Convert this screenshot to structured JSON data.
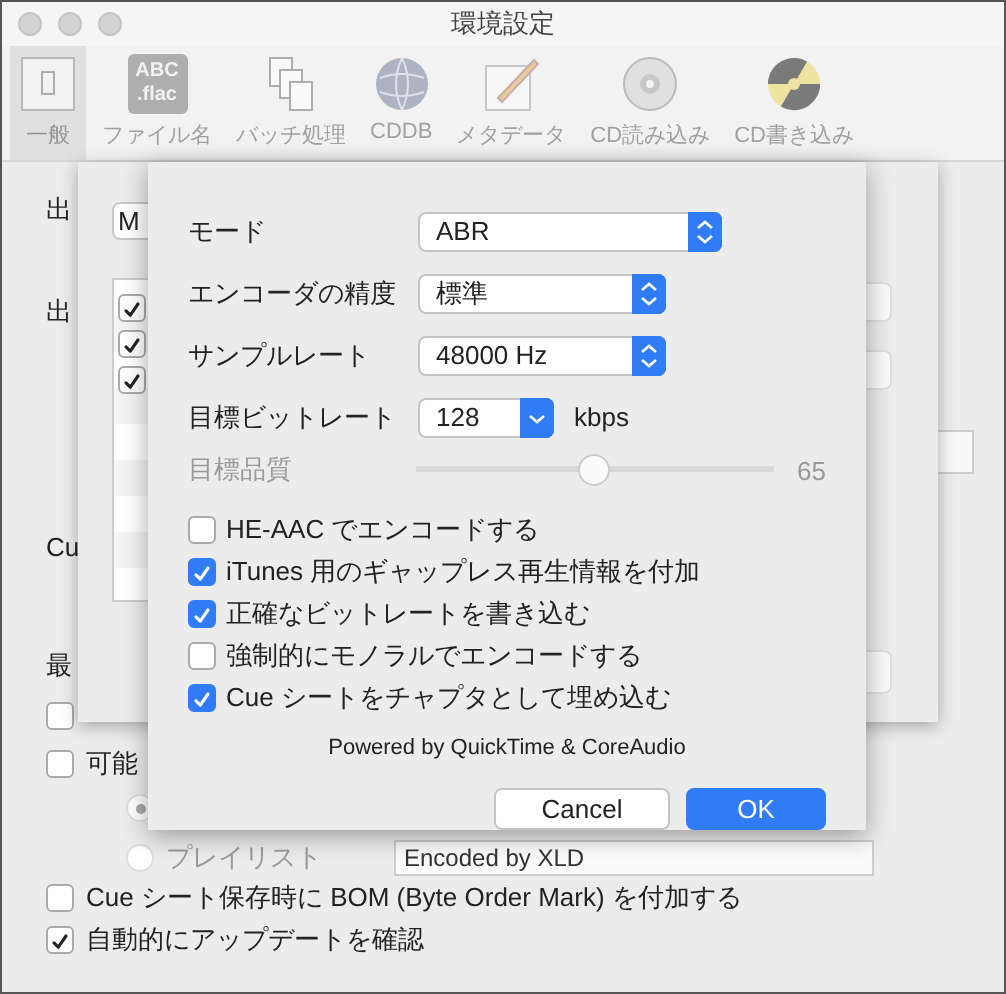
{
  "window": {
    "title": "環境設定"
  },
  "toolbar": [
    {
      "label": "一般",
      "selected": true
    },
    {
      "label": "ファイル名",
      "selected": false,
      "icon_text": [
        "ABC",
        ".flac"
      ]
    },
    {
      "label": "バッチ処理",
      "selected": false
    },
    {
      "label": "CDDB",
      "selected": false
    },
    {
      "label": "メタデータ",
      "selected": false
    },
    {
      "label": "CD読み込み",
      "selected": false
    },
    {
      "label": "CD書き込み",
      "selected": false
    }
  ],
  "general": {
    "rows": [
      {
        "kind": "label",
        "text": "出"
      },
      {
        "kind": "label",
        "text": "出"
      },
      {
        "kind": "label",
        "text": "Cu"
      },
      {
        "kind": "label",
        "text": "最"
      },
      {
        "kind": "checkbox",
        "checked": false
      },
      {
        "kind": "checkbox",
        "text": "可能",
        "checked": false
      },
      {
        "kind": "radio",
        "selected": true,
        "disabled": true
      },
      {
        "kind": "radio",
        "text": "プレイリスト",
        "selected": false,
        "disabled": true,
        "field": "Encoded by XLD"
      },
      {
        "kind": "checkbox",
        "text": "Cue シート保存時に BOM (Byte Order Mark) を付加する",
        "checked": false
      },
      {
        "kind": "checkbox",
        "text": "自動的にアップデートを確認",
        "checked": true
      }
    ]
  },
  "output_sheet": {
    "popup": "M",
    "list": [
      {
        "checked": true
      },
      {
        "checked": true
      },
      {
        "checked": true
      }
    ]
  },
  "encoder_sheet": {
    "rows": [
      {
        "kind": "popup",
        "label": "モード",
        "value": "ABR"
      },
      {
        "kind": "popup",
        "label": "エンコーダの精度",
        "value": "標準"
      },
      {
        "kind": "popup",
        "label": "サンプルレート",
        "value": "48000 Hz"
      },
      {
        "kind": "combo",
        "label": "目標ビットレート",
        "value": "128",
        "unit": "kbps"
      },
      {
        "kind": "slider",
        "label": "目標品質",
        "level": 0.5,
        "reading": "65",
        "disabled": true
      }
    ],
    "options": [
      {
        "label": "HE-AAC でエンコードする",
        "checked": false
      },
      {
        "label": "iTunes 用のギャップレス再生情報を付加",
        "checked": true
      },
      {
        "label": "正確なビットレートを書き込む",
        "checked": true
      },
      {
        "label": "強制的にモノラルでエンコードする",
        "checked": false
      },
      {
        "label": "Cue シートをチャプタとして埋め込む",
        "checked": true
      }
    ],
    "credit": "Powered by QuickTime & CoreAudio",
    "buttons": [
      {
        "label": "Cancel",
        "default": false
      },
      {
        "label": "OK",
        "default": true
      }
    ]
  }
}
